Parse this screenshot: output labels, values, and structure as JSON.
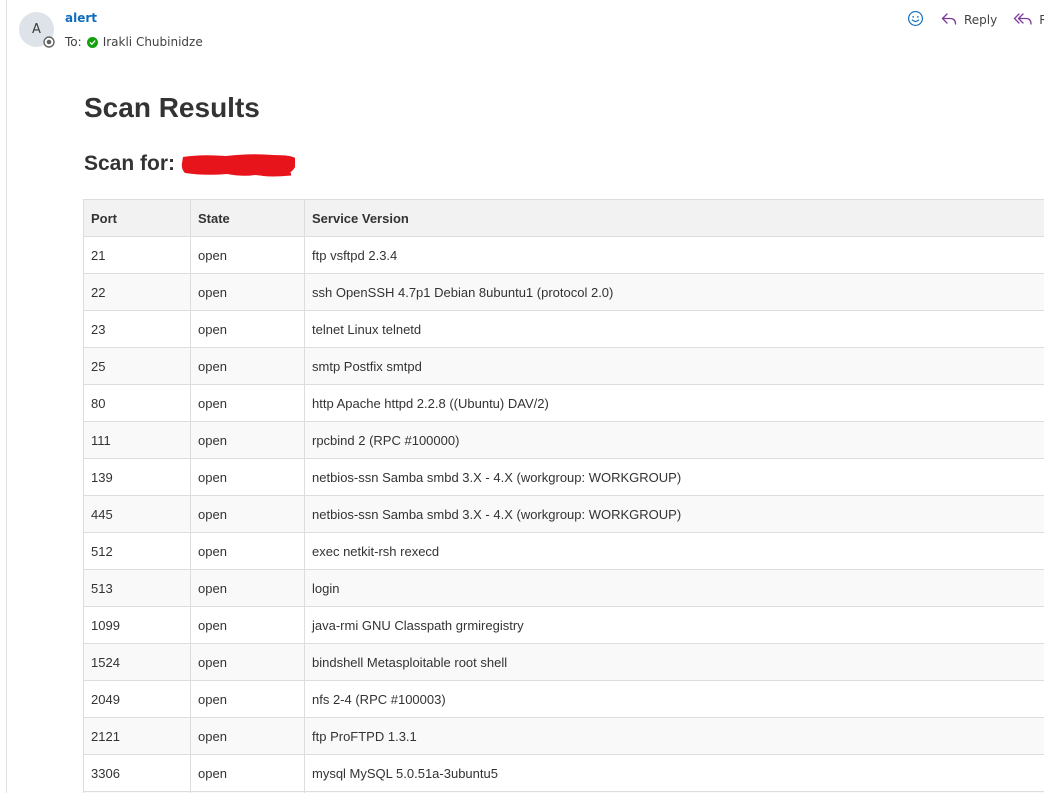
{
  "message": {
    "avatar_initial": "A",
    "sender": "alert",
    "to_label": "To:",
    "recipient": "Irakli Chubinidze",
    "actions": {
      "reply_label": "Reply",
      "reply_all_label": "Re"
    }
  },
  "body": {
    "title": "Scan Results",
    "scan_for_label": "Scan for:",
    "table": {
      "headers": [
        "Port",
        "State",
        "Service Version"
      ],
      "rows": [
        [
          "21",
          "open",
          "ftp vsftpd 2.3.4"
        ],
        [
          "22",
          "open",
          "ssh OpenSSH 4.7p1 Debian 8ubuntu1 (protocol 2.0)"
        ],
        [
          "23",
          "open",
          "telnet Linux telnetd"
        ],
        [
          "25",
          "open",
          "smtp Postfix smtpd"
        ],
        [
          "80",
          "open",
          "http Apache httpd 2.2.8 ((Ubuntu) DAV/2)"
        ],
        [
          "111",
          "open",
          "rpcbind 2 (RPC #100000)"
        ],
        [
          "139",
          "open",
          "netbios-ssn Samba smbd 3.X - 4.X (workgroup: WORKGROUP)"
        ],
        [
          "445",
          "open",
          "netbios-ssn Samba smbd 3.X - 4.X (workgroup: WORKGROUP)"
        ],
        [
          "512",
          "open",
          "exec netkit-rsh rexecd"
        ],
        [
          "513",
          "open",
          "login"
        ],
        [
          "1099",
          "open",
          "java-rmi GNU Classpath grmiregistry"
        ],
        [
          "1524",
          "open",
          "bindshell Metasploitable root shell"
        ],
        [
          "2049",
          "open",
          "nfs 2-4 (RPC #100003)"
        ],
        [
          "2121",
          "open",
          "ftp ProFTPD 1.3.1"
        ],
        [
          "3306",
          "open",
          "mysql MySQL 5.0.51a-3ubuntu5"
        ],
        [
          "",
          "",
          ""
        ]
      ]
    }
  },
  "colors": {
    "link_blue": "#0f6cbd",
    "presence_green": "#13a10e",
    "reply_purple": "#7a3a9a",
    "redaction_red": "#e8141c",
    "header_bg": "#f2f2f2",
    "row_alt_bg": "#f9f9f9"
  },
  "icons": {
    "emoji": "smiley-icon",
    "reply": "reply-arrow-icon",
    "reply_all": "reply-all-arrow-icon",
    "presence": "available-check-icon",
    "avatar_badge": "blocked-badge-icon"
  }
}
